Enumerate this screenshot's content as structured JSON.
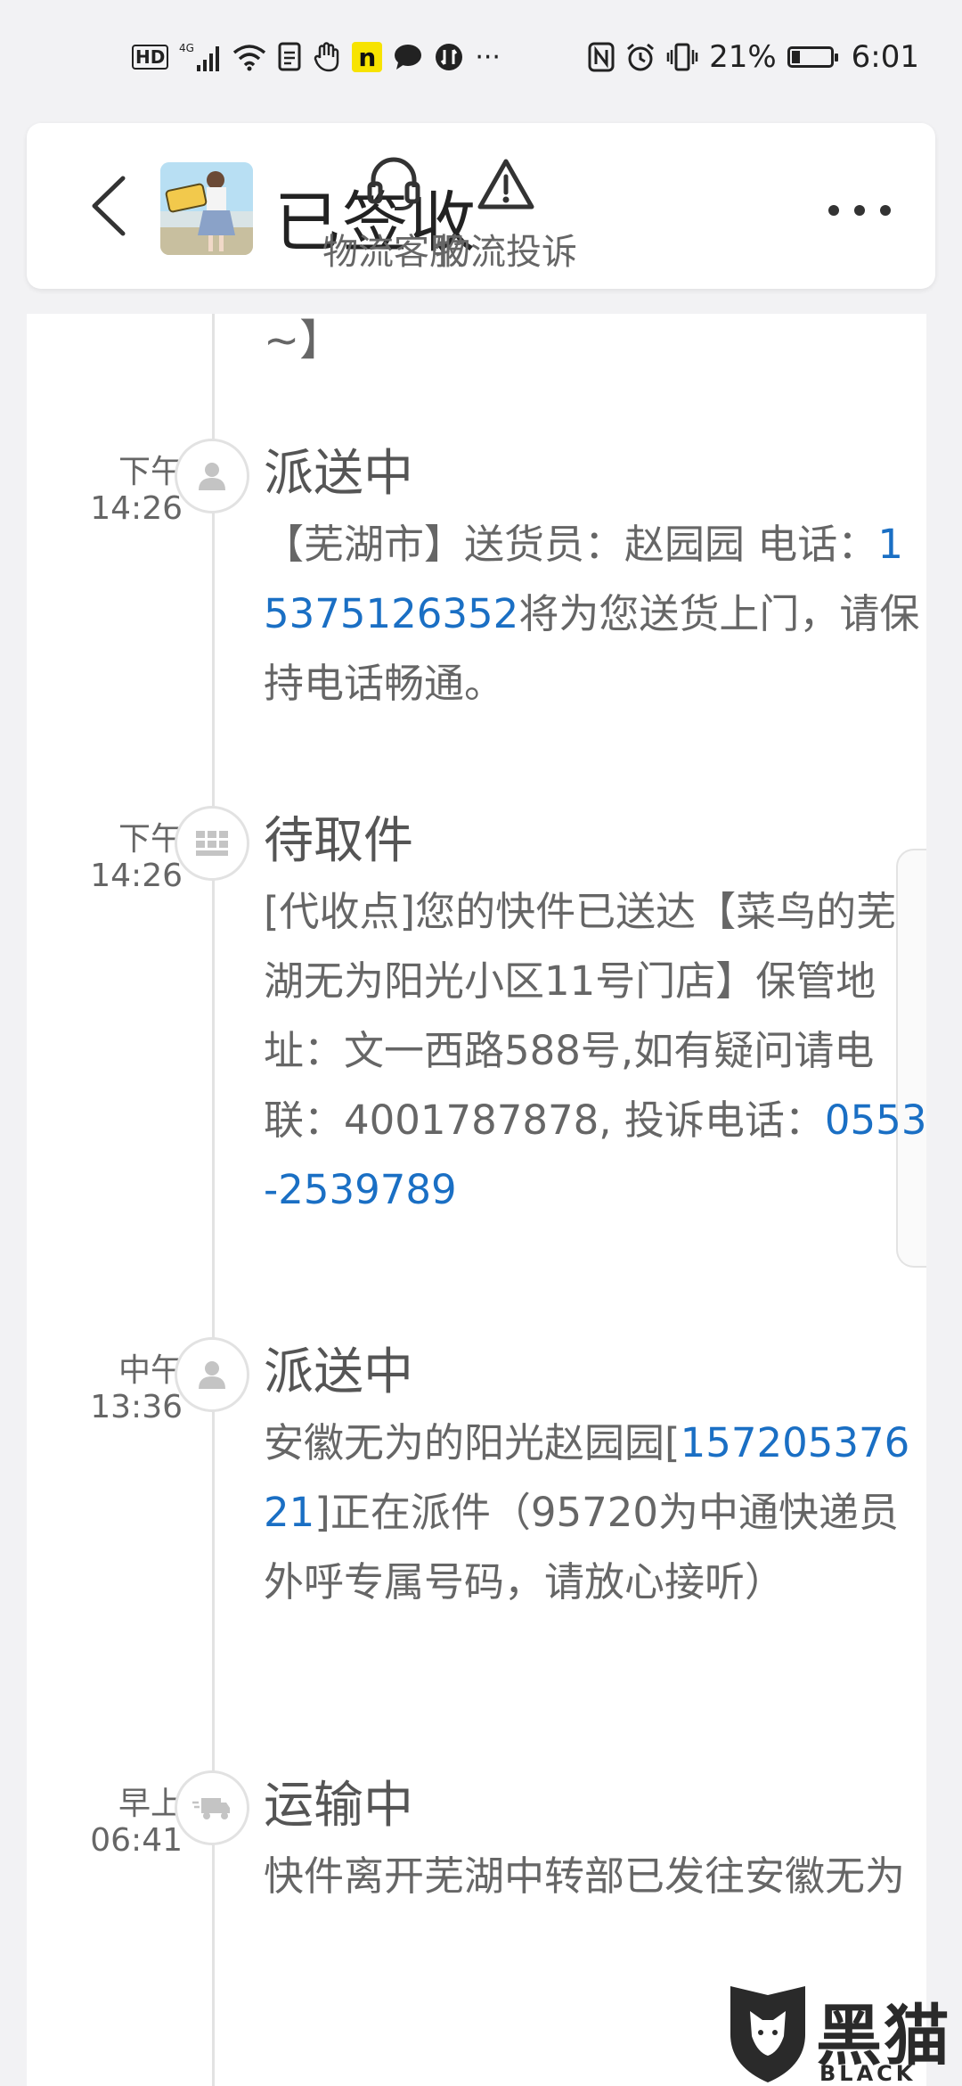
{
  "status_bar": {
    "hd": "HD",
    "network": "4G",
    "notif_badge": "n",
    "battery_percent": "21%",
    "battery_level": 0.21,
    "time": "6:01",
    "more": "···"
  },
  "header": {
    "title": "已签收",
    "actions": [
      {
        "label": "物流客服",
        "icon": "headset-icon"
      },
      {
        "label": "物流投诉",
        "icon": "warning-icon"
      }
    ],
    "more_icon": "more-dots-icon"
  },
  "timeline": {
    "top_fragment": "~】",
    "entries": [
      {
        "period": "下午",
        "time": "14:26",
        "icon": "person-icon",
        "status": "派送中",
        "desc_parts": [
          {
            "text": "【芜湖市】送货员：赵园园 电话：",
            "link": false
          },
          {
            "text": "15375126352",
            "link": true
          },
          {
            "text": "将为您送货上门，请保持电话畅通。",
            "link": false
          }
        ]
      },
      {
        "period": "下午",
        "time": "14:26",
        "icon": "grid-icon",
        "status": "待取件",
        "desc_parts": [
          {
            "text": "[代收点]您的快件已送达【菜鸟的芜湖无为阳光小区11号门店】保管地址：文一西路588号,如有疑问请电联：4001787878, 投诉电话：",
            "link": false
          },
          {
            "text": "0553-2539789",
            "link": true
          }
        ]
      },
      {
        "period": "中午",
        "time": "13:36",
        "icon": "person-icon",
        "status": "派送中",
        "desc_parts": [
          {
            "text": "安徽无为的阳光赵园园[",
            "link": false
          },
          {
            "text": "15720537621",
            "link": true
          },
          {
            "text": "]正在派件（95720为中通快递员外呼专属号码，请放心接听）",
            "link": false
          }
        ]
      },
      {
        "period": "早上",
        "time": "06:41",
        "icon": "truck-icon",
        "status": "运输中",
        "desc_parts": [
          {
            "text": "快件离开芜湖中转部已发往安徽无为",
            "link": false
          }
        ]
      }
    ]
  },
  "watermark": {
    "text": "黑猫",
    "sub": "BLACK CAT"
  },
  "colors": {
    "link": "#1a6fc4",
    "text": "#666666",
    "title": "#222222",
    "background": "#f2f2f4"
  }
}
